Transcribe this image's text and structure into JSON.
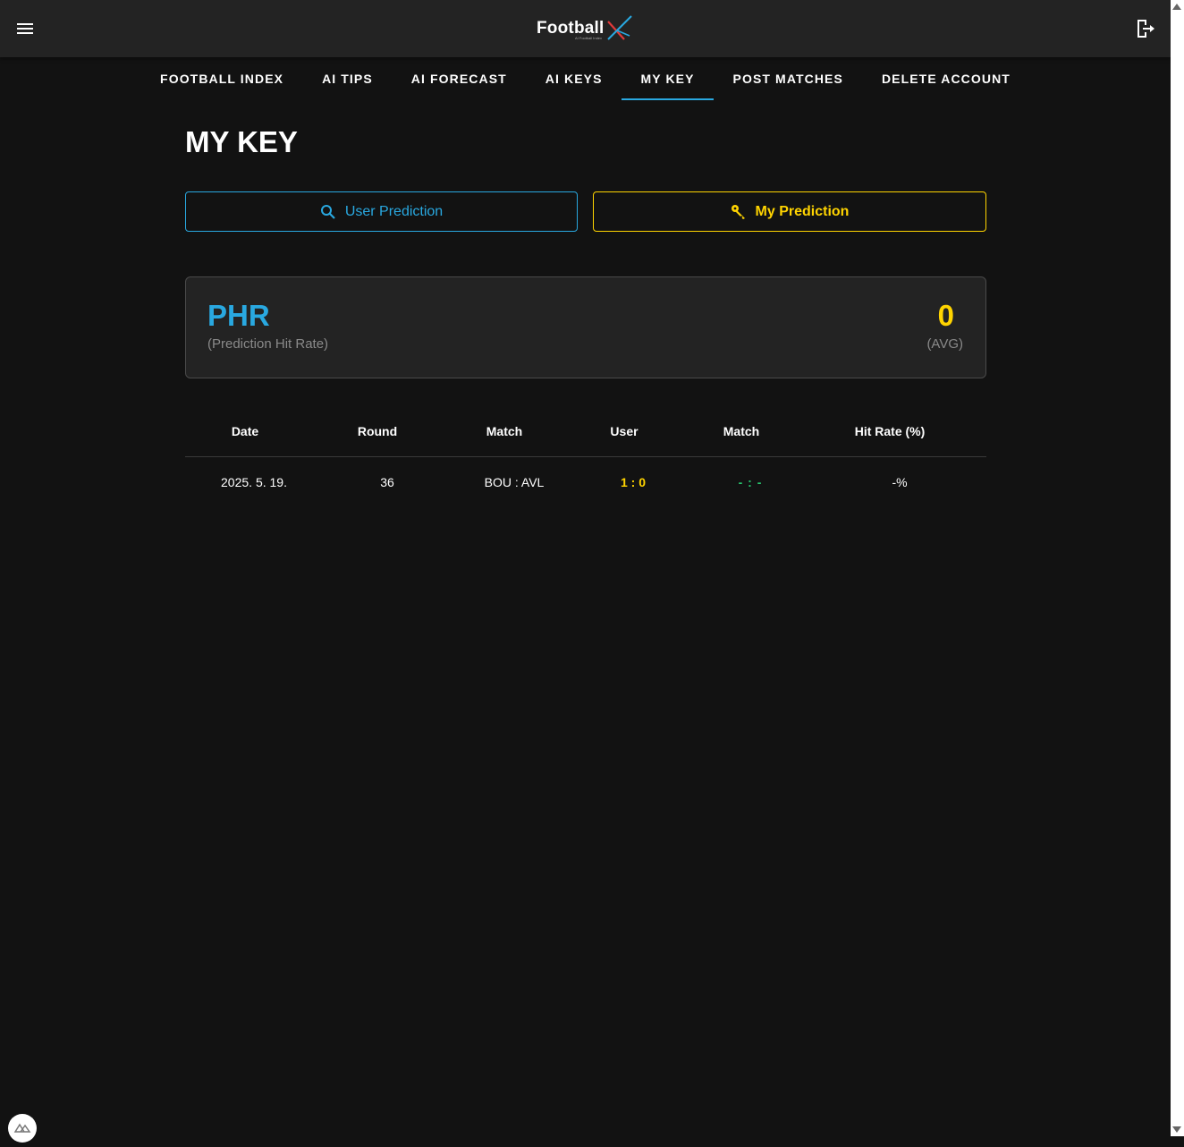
{
  "header": {
    "logo_text": "Football",
    "logo_subtitle": "AI Football Index",
    "menu_icon": "hamburger-menu-icon",
    "logout_icon": "logout-icon"
  },
  "nav": {
    "tabs": [
      {
        "label": "FOOTBALL INDEX",
        "active": false
      },
      {
        "label": "AI TIPS",
        "active": false
      },
      {
        "label": "AI FORECAST",
        "active": false
      },
      {
        "label": "AI KEYS",
        "active": false
      },
      {
        "label": "MY KEY",
        "active": true
      },
      {
        "label": "POST MATCHES",
        "active": false
      },
      {
        "label": "DELETE ACCOUNT",
        "active": false
      }
    ]
  },
  "page": {
    "title": "MY KEY"
  },
  "toggle": {
    "user_prediction_label": "User Prediction",
    "user_prediction_icon": "search-icon",
    "my_prediction_label": "My Prediction",
    "my_prediction_icon": "key-icon"
  },
  "stats": {
    "label": "PHR",
    "sublabel": "(Prediction Hit Rate)",
    "value": "0",
    "value_sublabel": "(AVG)"
  },
  "table": {
    "headers": [
      "Date",
      "Round",
      "Match",
      "User",
      "Match",
      "Hit Rate (%)"
    ],
    "rows": [
      {
        "date": "2025. 5. 19.",
        "round": "36",
        "match": "BOU : AVL",
        "user": "1 : 0",
        "result": "- : -",
        "hit_rate": "-%"
      }
    ]
  },
  "colors": {
    "background": "#121212",
    "header_bg": "#232323",
    "accent_blue": "#29a8e0",
    "accent_yellow": "#ffd400",
    "accent_green": "#28c76f",
    "logo_x_red": "#e03a3a"
  }
}
